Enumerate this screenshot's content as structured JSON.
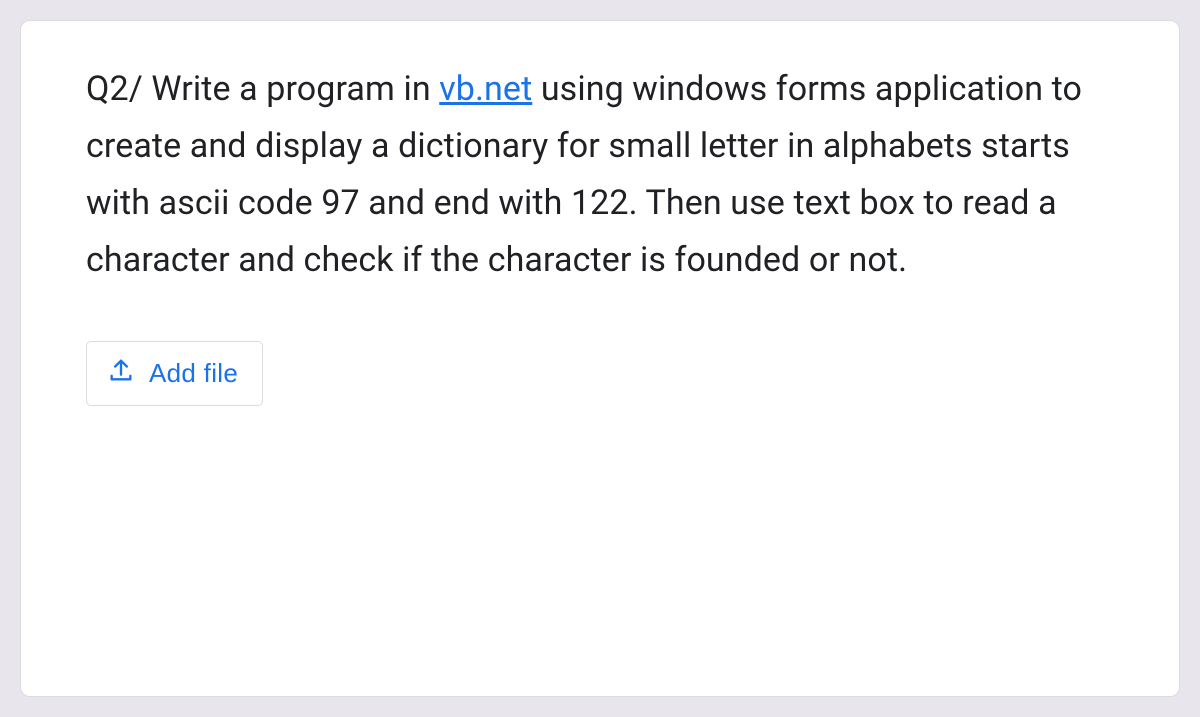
{
  "question": {
    "prefix": "Q2/ Write a program in ",
    "link_text": "vb.net",
    "suffix": " using windows forms application to create and display a dictionary for small letter in alphabets starts with ascii code 97 and end with 122. Then use text box to read a character and check if the character is founded or not."
  },
  "button": {
    "label": "Add file"
  }
}
